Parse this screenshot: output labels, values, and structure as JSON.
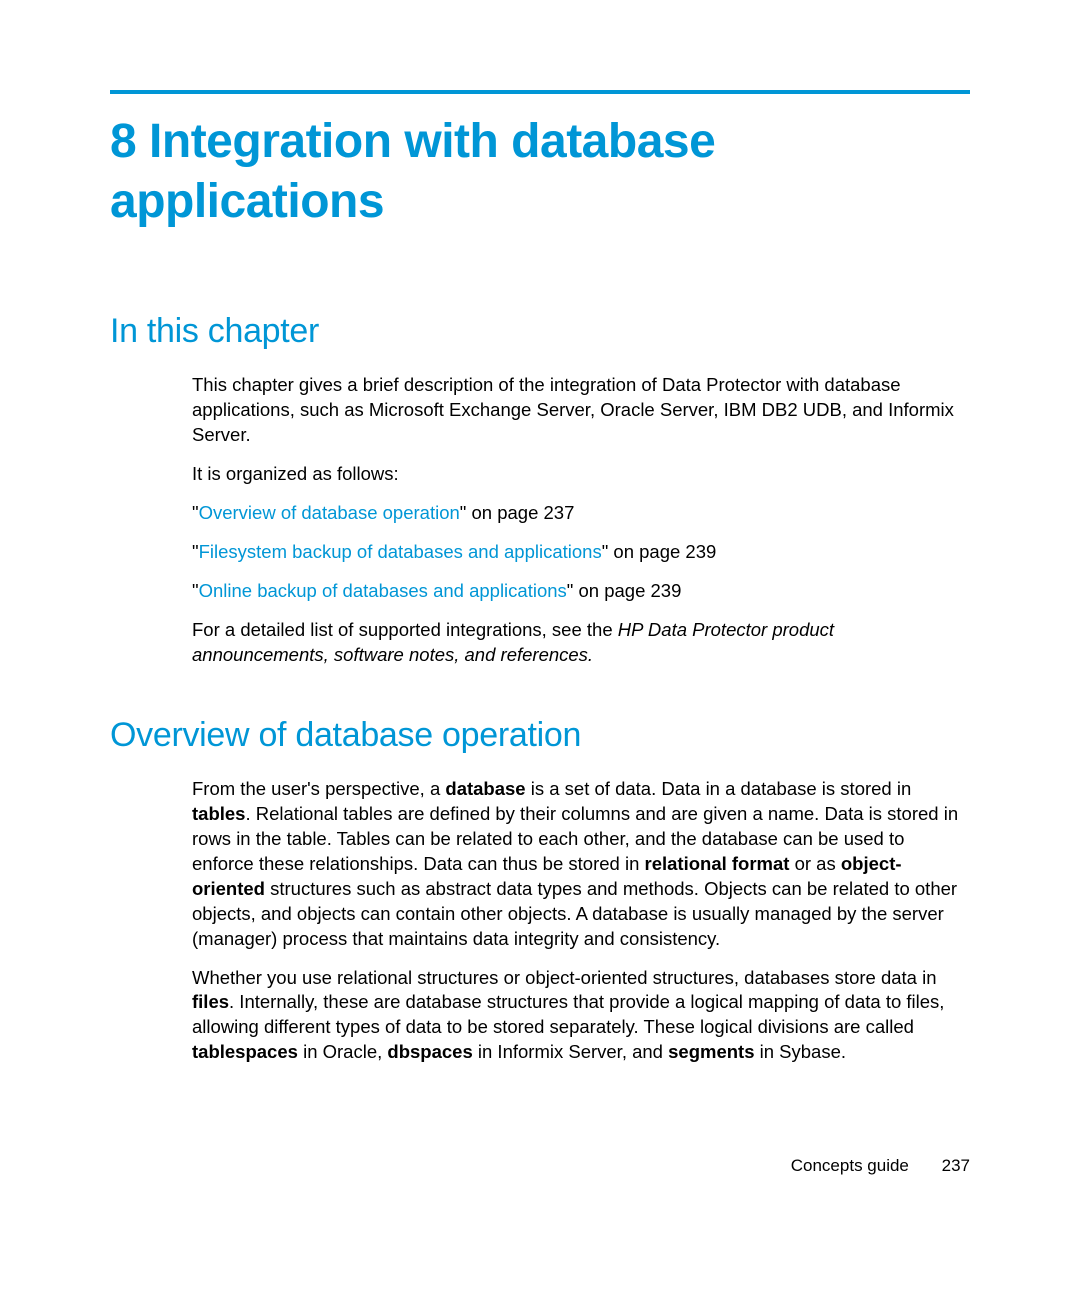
{
  "chapter": {
    "title": "8 Integration with database applications"
  },
  "sections": {
    "in_this_chapter": {
      "heading": "In this chapter",
      "p1": "This chapter gives a brief description of the integration of Data Protector with database applications, such as Microsoft Exchange Server, Oracle Server, IBM DB2 UDB, and Informix Server.",
      "p2": "It is organized as follows:",
      "link1": "Overview of database operation",
      "link1_suffix": "\" on page 237",
      "link2": "Filesystem backup of databases and applications",
      "link2_suffix": "\" on page 239",
      "link3": "Online backup of databases and applications",
      "link3_suffix": "\" on page 239",
      "p3_pre": "For a detailed list of supported integrations, see the ",
      "p3_italic": "HP Data Protector product announcements, software notes, and references."
    },
    "overview": {
      "heading": "Overview of database operation",
      "p1_a": "From the user's perspective, a ",
      "p1_b_database": "database",
      "p1_c": " is a set of data. Data in a database is stored in ",
      "p1_d_tables": "tables",
      "p1_e": ". Relational tables are defined by their columns and are given a name. Data is stored in rows in the table. Tables can be related to each other, and the database can be used to enforce these relationships. Data can thus be stored in ",
      "p1_f_relational": "relational format",
      "p1_g": " or as ",
      "p1_h_oo": "object-oriented",
      "p1_i": " structures such as abstract data types and methods. Objects can be related to other objects, and objects can contain other objects. A database is usually managed by the server (manager) process that maintains data integrity and consistency.",
      "p2_a": "Whether you use relational structures or object-oriented structures, databases store data in ",
      "p2_b_files": "files",
      "p2_c": ". Internally, these are database structures that provide a logical mapping of data to files, allowing different types of data to be stored separately. These logical divisions are called ",
      "p2_d_tablespaces": "tablespaces",
      "p2_e": " in Oracle, ",
      "p2_f_dbspaces": "dbspaces",
      "p2_g": " in Informix Server, and ",
      "p2_h_segments": "segments",
      "p2_i": " in Sybase."
    }
  },
  "footer": {
    "label": "Concepts guide",
    "page": "237"
  }
}
